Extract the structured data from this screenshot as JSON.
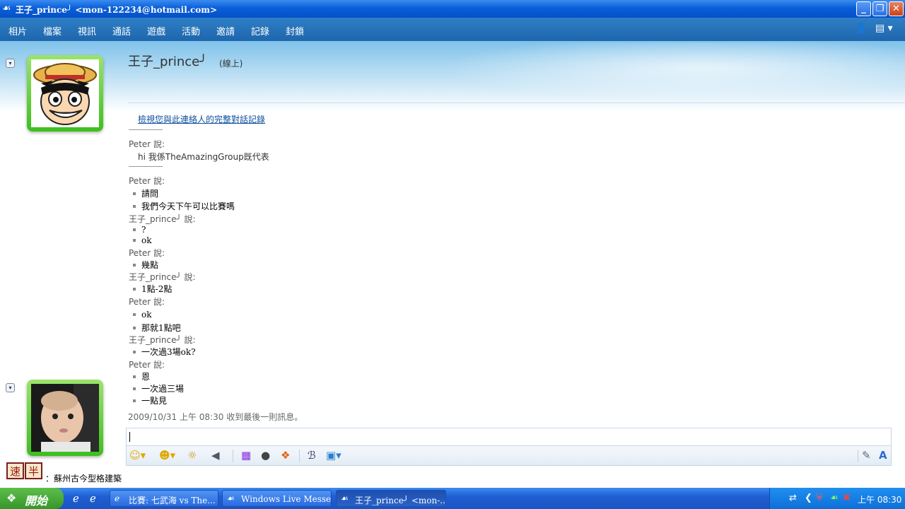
{
  "window": {
    "title": "王子_prince╯ <mon-122234@hotmail.com>",
    "min": "_",
    "max": "❐",
    "close": "✕"
  },
  "menu": [
    "相片",
    "檔案",
    "視訊",
    "通話",
    "遊戲",
    "活動",
    "邀請",
    "記錄",
    "封鎖"
  ],
  "contact": {
    "name": "王子_prince╯",
    "status": "(線上)",
    "history_link": "檢視您與此連絡人的完整對話記錄"
  },
  "conversation": {
    "first": {
      "sender": "Peter 說:",
      "text": "hi 我係TheAmazingGroup既代表"
    },
    "lines": [
      {
        "type": "sender",
        "text": "Peter 說:"
      },
      {
        "type": "msg",
        "text": "請問"
      },
      {
        "type": "msg",
        "text": "我們今天下午可以比賽嗎"
      },
      {
        "type": "sender",
        "text": "王子_prince╯ 說:"
      },
      {
        "type": "msg",
        "text": "?"
      },
      {
        "type": "msg",
        "text": "ok"
      },
      {
        "type": "sender",
        "text": "Peter 說:"
      },
      {
        "type": "msg",
        "text": "幾點"
      },
      {
        "type": "sender",
        "text": "王子_prince╯ 說:"
      },
      {
        "type": "msg",
        "text": "1點-2點"
      },
      {
        "type": "sender",
        "text": "Peter 說:"
      },
      {
        "type": "msg",
        "text": "ok"
      },
      {
        "type": "msg",
        "text": "那就1點吧"
      },
      {
        "type": "sender",
        "text": "王子_prince╯ 說:"
      },
      {
        "type": "msg",
        "text": "一次過3場ok?"
      },
      {
        "type": "sender",
        "text": "Peter 說:"
      },
      {
        "type": "msg",
        "text": "恩"
      },
      {
        "type": "msg",
        "text": "一次過三場"
      },
      {
        "type": "msg",
        "text": "一點見"
      }
    ],
    "timestamp": "2009/10/31 上午 08:30 收到最後一則訊息。"
  },
  "ime": {
    "mode1": "速",
    "mode2": "半"
  },
  "status_bar": "：蘇州古今型格建築",
  "taskbar": {
    "start": "開始",
    "tasks": [
      {
        "label": "比賽: 七武海 vs The..."
      },
      {
        "label": "Windows Live Messen..."
      },
      {
        "label": "王子_prince╯ <mon-..."
      }
    ],
    "clock": "上午 08:30"
  },
  "colors": {
    "menubar": "#1e66ad",
    "titlebar": "#0a5fd8",
    "taskbar": "#1f5fd3",
    "avatar_frame": "#3cbf1e"
  }
}
